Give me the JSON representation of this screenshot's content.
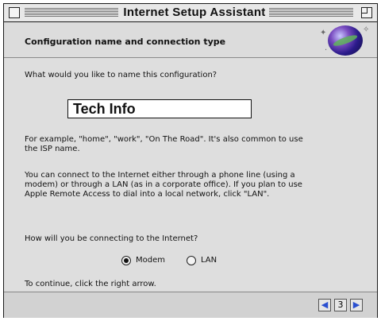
{
  "window": {
    "title": "Internet Setup Assistant"
  },
  "header": {
    "title": "Configuration name and connection type"
  },
  "main": {
    "prompt": "What would you like to name this configuration?",
    "name_value": "Tech Info",
    "example_line1": "For example, \"home\", \"work\", \"On The Road\". It's also common to use",
    "example_line2": "the ISP name.",
    "info_line1": "You can connect to the Internet either through a phone line (using a",
    "info_line2": "modem) or through a LAN (as in a corporate office). If you plan to use",
    "info_line3": "Apple Remote Access to dial into a local network, click \"LAN\".",
    "question": "How will you be connecting to the Internet?",
    "options": [
      {
        "label": "Modem",
        "selected": true
      },
      {
        "label": "LAN",
        "selected": false
      }
    ],
    "continue_text": "To continue, click the right arrow."
  },
  "nav": {
    "back_glyph": "◀",
    "page_glyph": "3",
    "next_glyph": "▶"
  },
  "icons": {
    "logo": "globe-icon",
    "close": "close-box-icon",
    "zoom": "zoom-box-icon"
  },
  "colors": {
    "nav_arrow": "#2a4fd0",
    "window_bg": "#dedede"
  }
}
